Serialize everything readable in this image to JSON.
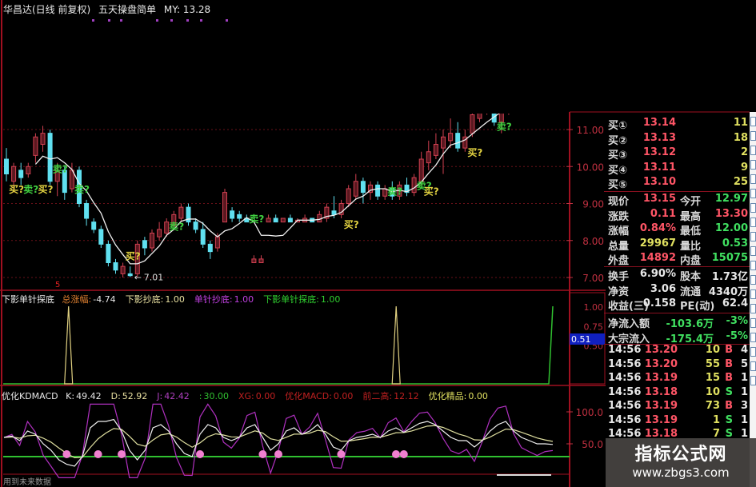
{
  "header": {
    "stock": "华昌达(日线 前复权)",
    "indicator": "五天操盘简单",
    "my": "MY: 13.28"
  },
  "colors": {
    "up": "#d04050",
    "down": "#60e0f0",
    "ma": "#f0f0f0",
    "grid": "#6a1018",
    "axis": "#c03040",
    "buy_signal": "#e0d040",
    "sell_signal": "#40d040"
  },
  "main_chart": {
    "price_axis": [
      "11.00",
      "10.00",
      "9.00",
      "8.00",
      "7.00"
    ],
    "low_label": "7.01",
    "marker": "5",
    "chart_data": {
      "type": "candlestick",
      "ylim": [
        7,
        12
      ],
      "ohlc": [
        [
          10.2,
          9.8,
          10.5,
          9.6
        ],
        [
          9.6,
          10.0,
          10.1,
          9.3
        ],
        [
          9.9,
          9.7,
          10.1,
          9.5
        ],
        [
          9.8,
          10.0,
          10.1,
          9.7
        ],
        [
          10.3,
          10.8,
          10.9,
          10.1
        ],
        [
          10.6,
          10.9,
          11.1,
          10.4
        ],
        [
          10.9,
          9.6,
          11.0,
          9.5
        ],
        [
          9.6,
          9.9,
          10.1,
          9.2
        ],
        [
          9.9,
          9.3,
          10.0,
          9.1
        ],
        [
          9.4,
          9.9,
          10.1,
          9.3
        ],
        [
          9.9,
          9.0,
          10.0,
          8.9
        ],
        [
          9.0,
          8.6,
          9.1,
          8.4
        ],
        [
          8.5,
          8.3,
          8.6,
          8.2
        ],
        [
          8.3,
          7.9,
          8.4,
          7.8
        ],
        [
          7.9,
          7.4,
          8.0,
          7.3
        ],
        [
          7.4,
          7.2,
          7.5,
          7.1
        ],
        [
          7.1,
          7.3,
          7.4,
          7.0
        ],
        [
          7.1,
          7.05,
          7.3,
          7.01
        ],
        [
          7.1,
          7.9,
          8.0,
          7.01
        ],
        [
          8.0,
          7.8,
          8.1,
          7.6
        ],
        [
          7.8,
          8.2,
          8.3,
          7.7
        ],
        [
          8.1,
          8.3,
          8.5,
          8.0
        ],
        [
          8.2,
          8.5,
          8.6,
          8.1
        ],
        [
          8.4,
          8.7,
          8.8,
          8.3
        ],
        [
          8.6,
          8.9,
          9.0,
          8.5
        ],
        [
          8.9,
          8.5,
          9.0,
          8.4
        ],
        [
          8.5,
          8.3,
          8.6,
          8.2
        ],
        [
          8.3,
          7.9,
          8.5,
          7.8
        ],
        [
          7.9,
          7.7,
          8.0,
          7.5
        ],
        [
          7.8,
          8.1,
          8.2,
          7.7
        ],
        [
          8.5,
          9.3,
          9.4,
          8.5
        ],
        [
          8.8,
          8.6,
          8.9,
          8.5
        ],
        [
          8.7,
          8.6,
          8.8,
          8.5
        ],
        [
          8.6,
          8.5,
          8.7,
          8.5
        ],
        [
          7.4,
          7.5,
          7.6,
          7.4
        ],
        [
          7.4,
          7.5,
          7.6,
          7.4
        ],
        [
          8.5,
          8.6,
          8.7,
          8.5
        ],
        [
          8.6,
          8.5,
          8.7,
          8.5
        ],
        [
          8.5,
          8.6,
          8.6,
          8.5
        ],
        [
          8.6,
          8.5,
          8.7,
          8.5
        ],
        [
          8.5,
          8.55,
          8.6,
          8.5
        ],
        [
          8.5,
          8.6,
          8.7,
          8.5
        ],
        [
          8.6,
          8.5,
          8.6,
          8.5
        ],
        [
          8.5,
          8.7,
          8.8,
          8.5
        ],
        [
          8.6,
          8.9,
          9.0,
          8.5
        ],
        [
          8.8,
          8.7,
          9.2,
          8.6
        ],
        [
          8.7,
          9.0,
          9.1,
          8.6
        ],
        [
          9.0,
          9.4,
          9.5,
          8.9
        ],
        [
          9.2,
          9.6,
          9.8,
          9.1
        ],
        [
          9.6,
          9.3,
          9.7,
          9.0
        ],
        [
          9.3,
          9.5,
          9.6,
          9.1
        ],
        [
          9.5,
          9.2,
          9.6,
          9.1
        ],
        [
          9.2,
          9.4,
          9.5,
          9.1
        ],
        [
          9.4,
          9.2,
          9.6,
          9.1
        ],
        [
          9.2,
          9.5,
          9.6,
          9.1
        ],
        [
          9.5,
          9.3,
          9.7,
          9.2
        ],
        [
          9.3,
          9.7,
          9.8,
          9.2
        ],
        [
          9.6,
          10.2,
          10.4,
          9.5
        ],
        [
          10.1,
          10.4,
          10.7,
          9.9
        ],
        [
          10.3,
          10.6,
          10.9,
          10.2
        ],
        [
          10.5,
          10.8,
          11.0,
          9.8
        ],
        [
          10.7,
          10.9,
          11.3,
          10.5
        ],
        [
          10.9,
          10.5,
          11.2,
          10.4
        ],
        [
          10.5,
          10.8,
          11.0,
          10.4
        ],
        [
          10.9,
          11.4,
          11.5,
          10.8
        ],
        [
          11.3,
          11.6,
          11.7,
          11.2
        ],
        [
          11.5,
          11.7,
          11.8,
          11.4
        ],
        [
          11.7,
          11.2,
          11.8,
          11.1
        ],
        [
          11.2,
          11.5,
          11.6,
          10.9
        ],
        [
          11.5,
          11.7,
          11.8,
          11.4
        ]
      ],
      "signals": [
        {
          "bar": 1,
          "price": 9.4,
          "text": "买?",
          "type": "buy"
        },
        {
          "bar": 3,
          "price": 9.4,
          "text": "卖?",
          "type": "sell"
        },
        {
          "bar": 5,
          "price": 9.4,
          "text": "买?",
          "type": "buy"
        },
        {
          "bar": 7,
          "price": 9.95,
          "text": "卖?",
          "type": "sell"
        },
        {
          "bar": 10,
          "price": 9.4,
          "text": "卖?",
          "type": "sell"
        },
        {
          "bar": 17,
          "price": 7.6,
          "text": "买?",
          "type": "buy"
        },
        {
          "bar": 23,
          "price": 8.4,
          "text": "卖?",
          "type": "sell"
        },
        {
          "bar": 34,
          "price": 8.6,
          "text": "卖?",
          "type": "sell"
        },
        {
          "bar": 47,
          "price": 8.45,
          "text": "买?",
          "type": "buy"
        },
        {
          "bar": 53,
          "price": 9.35,
          "text": "卖?",
          "type": "sell"
        },
        {
          "bar": 57,
          "price": 9.5,
          "text": "卖?",
          "type": "sell"
        },
        {
          "bar": 58,
          "price": 9.35,
          "text": "买?",
          "type": "buy"
        },
        {
          "bar": 64,
          "price": 10.4,
          "text": "买?",
          "type": "buy"
        },
        {
          "bar": 68,
          "price": 11.1,
          "text": "卖?",
          "type": "sell"
        }
      ]
    }
  },
  "indicator1": {
    "name": "下影单针探底",
    "items": [
      {
        "label": "总涨幅:",
        "value": "-4.74",
        "color": "#e08030"
      },
      {
        "label": "下影抄底:",
        "value": "1.00",
        "color": "#e8e0a0"
      },
      {
        "label": "单针抄底:",
        "value": "1.00",
        "color": "#c040e0"
      },
      {
        "label": "下影单针探底:",
        "value": "1.00",
        "color": "#30d030"
      }
    ],
    "axis": [
      "1.00",
      "0.75",
      "0.50"
    ],
    "current": "0.51",
    "chart_data": {
      "type": "spike",
      "ylim": [
        0,
        1
      ],
      "spikes": [
        {
          "bar": 7,
          "value": 1
        },
        {
          "bar": 52,
          "value": 1
        }
      ],
      "last_value": 1
    }
  },
  "indicator2": {
    "name": "优化KDMACD",
    "items": [
      {
        "label": "K:",
        "value": "49.42",
        "color": "#e8e8e8"
      },
      {
        "label": "D:",
        "value": "52.92",
        "color": "#e8e0a0"
      },
      {
        "label": "J:",
        "value": "42.42",
        "color": "#b040c0"
      },
      {
        "label": ":",
        "value": "30.00",
        "color": "#30c030"
      },
      {
        "label": "XG:",
        "value": "0.00",
        "color": "#c02020"
      },
      {
        "label": "优化MACD:",
        "value": "0.00",
        "color": "#c02020"
      },
      {
        "label": "前二高:",
        "value": "12.12",
        "color": "#c02020"
      },
      {
        "label": "优化精品:",
        "value": "0.00",
        "color": "#e0e060"
      }
    ],
    "axis": [
      "100.0",
      "50.0"
    ],
    "footer": "用到未来数据",
    "chart_data": {
      "type": "line",
      "ylim": [
        0,
        100
      ],
      "level": 30,
      "K": [
        60,
        62,
        55,
        70,
        65,
        50,
        40,
        25,
        18,
        15,
        30,
        75,
        85,
        85,
        88,
        70,
        40,
        25,
        40,
        75,
        80,
        70,
        50,
        35,
        30,
        65,
        80,
        75,
        60,
        55,
        60,
        75,
        80,
        60,
        40,
        50,
        70,
        75,
        65,
        70,
        80,
        65,
        45,
        40,
        55,
        60,
        62,
        65,
        60,
        70,
        75,
        68,
        75,
        82,
        85,
        80,
        70,
        60,
        55,
        55,
        45,
        55,
        70,
        80,
        85,
        70,
        60,
        55,
        50,
        50,
        49
      ],
      "cross_marks": [
        8,
        12,
        15,
        25,
        33,
        35,
        43,
        50,
        51
      ]
    }
  },
  "quote_panel": {
    "bids": [
      {
        "label": "买①",
        "price": "13.14",
        "vol": "11"
      },
      {
        "label": "买②",
        "price": "13.13",
        "vol": "18"
      },
      {
        "label": "买③",
        "price": "13.12",
        "vol": "2"
      },
      {
        "label": "买④",
        "price": "13.11",
        "vol": "9"
      },
      {
        "label": "买⑤",
        "price": "13.10",
        "vol": "25"
      }
    ],
    "stats": [
      [
        {
          "l": "现价",
          "v": "13.15",
          "c": "red"
        },
        {
          "l": "今开",
          "v": "12.97",
          "c": "grn"
        }
      ],
      [
        {
          "l": "涨跌",
          "v": "0.11",
          "c": "red"
        },
        {
          "l": "最高",
          "v": "13.30",
          "c": "red"
        }
      ],
      [
        {
          "l": "涨幅",
          "v": "0.84%",
          "c": "red"
        },
        {
          "l": "最低",
          "v": "12.00",
          "c": "grn"
        }
      ],
      [
        {
          "l": "总量",
          "v": "29967",
          "c": "yel"
        },
        {
          "l": "量比",
          "v": "0.53",
          "c": "grn"
        }
      ],
      [
        {
          "l": "外盘",
          "v": "14892",
          "c": "red"
        },
        {
          "l": "内盘",
          "v": "15075",
          "c": "grn"
        }
      ]
    ],
    "finance": [
      [
        {
          "l": "换手",
          "v": "6.90%"
        },
        {
          "l": "股本",
          "v": "1.73亿"
        }
      ],
      [
        {
          "l": "净资",
          "v": "3.06"
        },
        {
          "l": "流通",
          "v": "4340万"
        }
      ],
      [
        {
          "l": "收益(三)",
          "v": "0.158"
        },
        {
          "l": "PE(动)",
          "v": "62.4"
        }
      ]
    ],
    "flows": [
      {
        "l": "净流入额",
        "v": "-103.6万",
        "p": "-3%"
      },
      {
        "l": "大宗流入",
        "v": "-175.4万",
        "p": "-5%"
      }
    ],
    "trades": [
      {
        "t": "14:56",
        "p": "13.20",
        "v": "10",
        "s": "B",
        "n": "4"
      },
      {
        "t": "14:56",
        "p": "13.20",
        "v": "55",
        "s": "B",
        "n": "5"
      },
      {
        "t": "14:56",
        "p": "13.19",
        "v": "15",
        "s": "B",
        "n": "1"
      },
      {
        "t": "14:56",
        "p": "13.18",
        "v": "10",
        "s": "S",
        "n": "1"
      },
      {
        "t": "14:56",
        "p": "13.19",
        "v": "73",
        "s": "B",
        "n": "3"
      },
      {
        "t": "14:56",
        "p": "13.19",
        "v": "1",
        "s": "S",
        "n": "1"
      },
      {
        "t": "14:56",
        "p": "13.18",
        "v": "7",
        "s": "S",
        "n": "1"
      }
    ]
  },
  "watermark": {
    "name": "指标公式网",
    "url": "www.zbgs3.com"
  }
}
